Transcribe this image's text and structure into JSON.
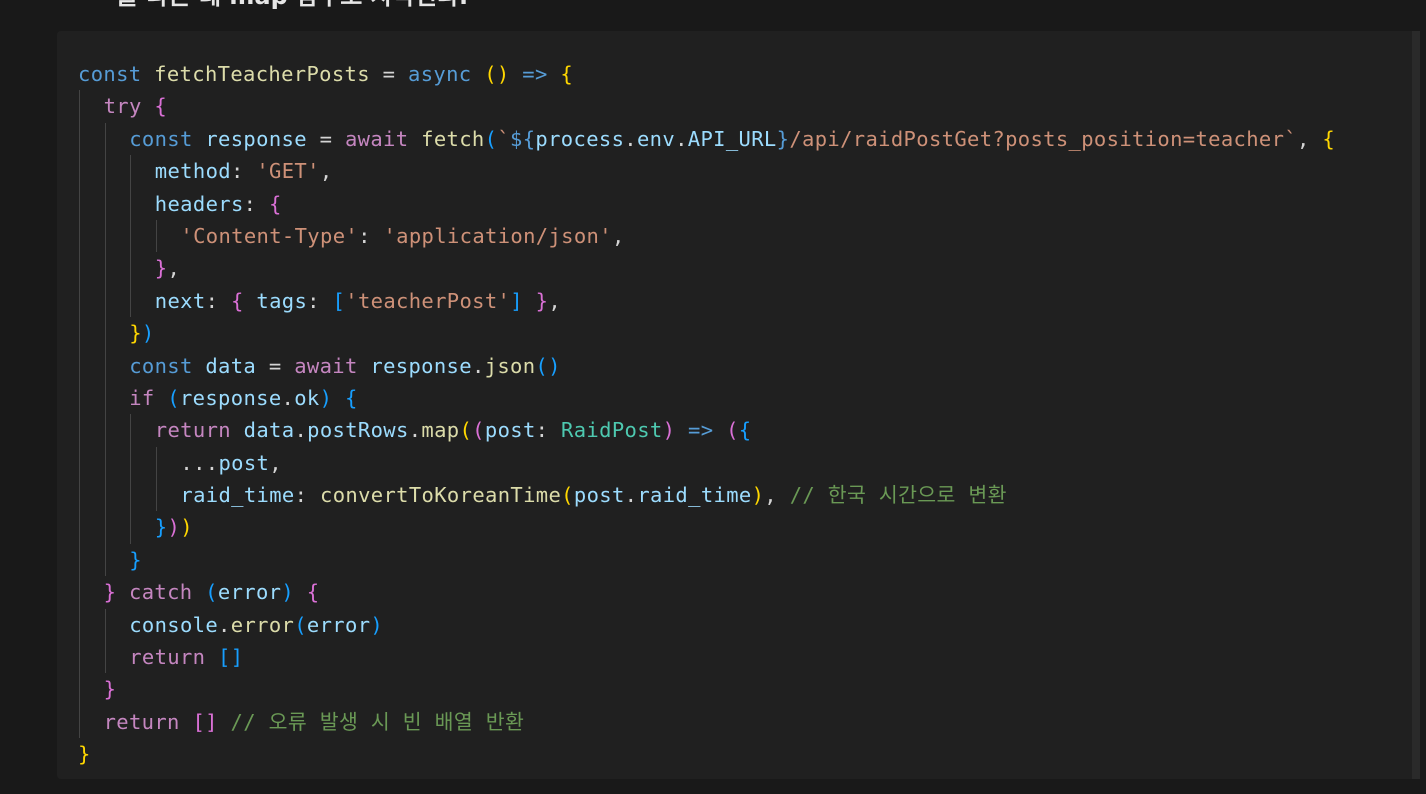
{
  "heading": {
    "text": "을 다른 데 map 함수로 사각된다."
  },
  "code": {
    "language": "typescript",
    "lines": [
      {
        "indent": 0,
        "tokens": [
          {
            "t": "const",
            "c": "kw"
          },
          {
            "t": " "
          },
          {
            "t": "fetchTeacherPosts",
            "c": "fn"
          },
          {
            "t": " = "
          },
          {
            "t": "async",
            "c": "kw"
          },
          {
            "t": " "
          },
          {
            "t": "()",
            "c": "b1"
          },
          {
            "t": " "
          },
          {
            "t": "=>",
            "c": "kw"
          },
          {
            "t": " "
          },
          {
            "t": "{",
            "c": "b1"
          }
        ]
      },
      {
        "indent": 1,
        "tokens": [
          {
            "t": "try",
            "c": "ctl"
          },
          {
            "t": " "
          },
          {
            "t": "{",
            "c": "b2"
          }
        ]
      },
      {
        "indent": 2,
        "tokens": [
          {
            "t": "const",
            "c": "kw"
          },
          {
            "t": " "
          },
          {
            "t": "response",
            "c": "var"
          },
          {
            "t": " = "
          },
          {
            "t": "await",
            "c": "ctl"
          },
          {
            "t": " "
          },
          {
            "t": "fetch",
            "c": "fn"
          },
          {
            "t": "(",
            "c": "b3"
          },
          {
            "t": "`",
            "c": "str"
          },
          {
            "t": "${",
            "c": "kw"
          },
          {
            "t": "process",
            "c": "var"
          },
          {
            "t": "."
          },
          {
            "t": "env",
            "c": "var"
          },
          {
            "t": "."
          },
          {
            "t": "API_URL",
            "c": "var"
          },
          {
            "t": "}",
            "c": "kw"
          },
          {
            "t": "/api/raidPostGet?posts_position=teacher`",
            "c": "str"
          },
          {
            "t": ", "
          },
          {
            "t": "{",
            "c": "b1"
          }
        ]
      },
      {
        "indent": 3,
        "tokens": [
          {
            "t": "method",
            "c": "var"
          },
          {
            "t": ": "
          },
          {
            "t": "'GET'",
            "c": "str"
          },
          {
            "t": ","
          }
        ]
      },
      {
        "indent": 3,
        "tokens": [
          {
            "t": "headers",
            "c": "var"
          },
          {
            "t": ": "
          },
          {
            "t": "{",
            "c": "b2"
          }
        ]
      },
      {
        "indent": 4,
        "tokens": [
          {
            "t": "'Content-Type'",
            "c": "str"
          },
          {
            "t": ": "
          },
          {
            "t": "'application/json'",
            "c": "str"
          },
          {
            "t": ","
          }
        ]
      },
      {
        "indent": 3,
        "tokens": [
          {
            "t": "}",
            "c": "b2"
          },
          {
            "t": ","
          }
        ]
      },
      {
        "indent": 3,
        "tokens": [
          {
            "t": "next",
            "c": "var"
          },
          {
            "t": ": "
          },
          {
            "t": "{",
            "c": "b2"
          },
          {
            "t": " "
          },
          {
            "t": "tags",
            "c": "var"
          },
          {
            "t": ": "
          },
          {
            "t": "[",
            "c": "b3"
          },
          {
            "t": "'teacherPost'",
            "c": "str"
          },
          {
            "t": "]",
            "c": "b3"
          },
          {
            "t": " "
          },
          {
            "t": "}",
            "c": "b2"
          },
          {
            "t": ","
          }
        ]
      },
      {
        "indent": 2,
        "tokens": [
          {
            "t": "}",
            "c": "b1"
          },
          {
            "t": ")",
            "c": "b3"
          }
        ]
      },
      {
        "indent": 2,
        "tokens": [
          {
            "t": "const",
            "c": "kw"
          },
          {
            "t": " "
          },
          {
            "t": "data",
            "c": "var"
          },
          {
            "t": " = "
          },
          {
            "t": "await",
            "c": "ctl"
          },
          {
            "t": " "
          },
          {
            "t": "response",
            "c": "var"
          },
          {
            "t": "."
          },
          {
            "t": "json",
            "c": "fn"
          },
          {
            "t": "()",
            "c": "b3"
          }
        ]
      },
      {
        "indent": 2,
        "tokens": [
          {
            "t": "if",
            "c": "ctl"
          },
          {
            "t": " "
          },
          {
            "t": "(",
            "c": "b3"
          },
          {
            "t": "response",
            "c": "var"
          },
          {
            "t": "."
          },
          {
            "t": "ok",
            "c": "var"
          },
          {
            "t": ")",
            "c": "b3"
          },
          {
            "t": " "
          },
          {
            "t": "{",
            "c": "b3"
          }
        ]
      },
      {
        "indent": 3,
        "tokens": [
          {
            "t": "return",
            "c": "ctl"
          },
          {
            "t": " "
          },
          {
            "t": "data",
            "c": "var"
          },
          {
            "t": "."
          },
          {
            "t": "postRows",
            "c": "var"
          },
          {
            "t": "."
          },
          {
            "t": "map",
            "c": "fn"
          },
          {
            "t": "(",
            "c": "b1"
          },
          {
            "t": "(",
            "c": "b2"
          },
          {
            "t": "post",
            "c": "var"
          },
          {
            "t": ": "
          },
          {
            "t": "RaidPost",
            "c": "type"
          },
          {
            "t": ")",
            "c": "b2"
          },
          {
            "t": " "
          },
          {
            "t": "=>",
            "c": "kw"
          },
          {
            "t": " "
          },
          {
            "t": "(",
            "c": "b2"
          },
          {
            "t": "{",
            "c": "b3"
          }
        ]
      },
      {
        "indent": 4,
        "tokens": [
          {
            "t": "..."
          },
          {
            "t": "post",
            "c": "var"
          },
          {
            "t": ","
          }
        ]
      },
      {
        "indent": 4,
        "tokens": [
          {
            "t": "raid_time",
            "c": "var"
          },
          {
            "t": ": "
          },
          {
            "t": "convertToKoreanTime",
            "c": "fn"
          },
          {
            "t": "(",
            "c": "b1"
          },
          {
            "t": "post",
            "c": "var"
          },
          {
            "t": "."
          },
          {
            "t": "raid_time",
            "c": "var"
          },
          {
            "t": ")",
            "c": "b1"
          },
          {
            "t": ", "
          },
          {
            "t": "// 한국 시간으로 변환",
            "c": "cmt"
          }
        ]
      },
      {
        "indent": 3,
        "tokens": [
          {
            "t": "}",
            "c": "b3"
          },
          {
            "t": ")",
            "c": "b2"
          },
          {
            "t": ")",
            "c": "b1"
          }
        ]
      },
      {
        "indent": 2,
        "tokens": [
          {
            "t": "}",
            "c": "b3"
          }
        ]
      },
      {
        "indent": 1,
        "tokens": [
          {
            "t": "}",
            "c": "b2"
          },
          {
            "t": " "
          },
          {
            "t": "catch",
            "c": "ctl"
          },
          {
            "t": " "
          },
          {
            "t": "(",
            "c": "b3"
          },
          {
            "t": "error",
            "c": "var"
          },
          {
            "t": ")",
            "c": "b3"
          },
          {
            "t": " "
          },
          {
            "t": "{",
            "c": "b2"
          }
        ]
      },
      {
        "indent": 2,
        "tokens": [
          {
            "t": "console",
            "c": "var"
          },
          {
            "t": "."
          },
          {
            "t": "error",
            "c": "fn"
          },
          {
            "t": "(",
            "c": "b3"
          },
          {
            "t": "error",
            "c": "var"
          },
          {
            "t": ")",
            "c": "b3"
          }
        ]
      },
      {
        "indent": 2,
        "tokens": [
          {
            "t": "return",
            "c": "ctl"
          },
          {
            "t": " "
          },
          {
            "t": "[]",
            "c": "b3"
          }
        ]
      },
      {
        "indent": 1,
        "tokens": [
          {
            "t": "}",
            "c": "b2"
          }
        ]
      },
      {
        "indent": 1,
        "tokens": [
          {
            "t": "return",
            "c": "ctl"
          },
          {
            "t": " "
          },
          {
            "t": "[]",
            "c": "b2"
          },
          {
            "t": " "
          },
          {
            "t": "// 오류 발생 시 빈 배열 반환",
            "c": "cmt"
          }
        ]
      },
      {
        "indent": 0,
        "tokens": [
          {
            "t": "}",
            "c": "b1"
          }
        ]
      }
    ]
  }
}
